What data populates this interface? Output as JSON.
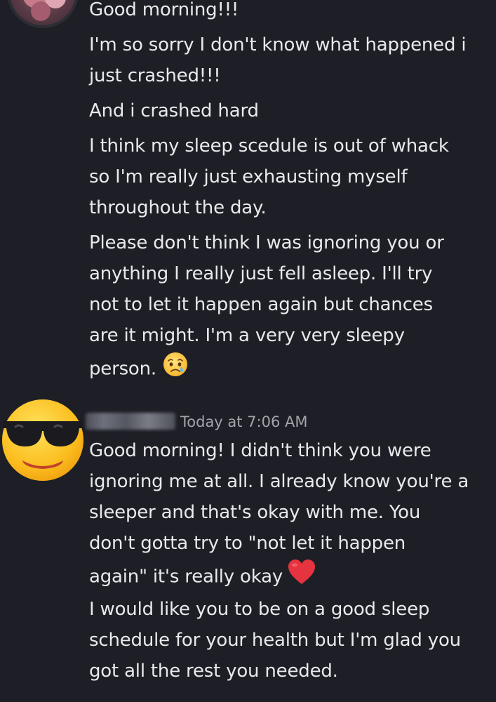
{
  "messages_prev": {
    "lines": [
      "Good morning!!!",
      "I'm so sorry I don't know what happened i",
      "just crashed!!!",
      "And i crashed hard",
      "I think my sleep scedule is out of whack",
      "so I'm really just exhausting myself",
      "throughout the day.",
      "Please don't think I was ignoring you or",
      "anything I really just fell asleep. I'll try",
      "not to let it happen again but chances",
      "are it might. I'm a very very sleepy",
      "person."
    ],
    "avatar_icon": "profile-photo",
    "end_emoji_icon": "crying-face-emoji"
  },
  "message_reply": {
    "timestamp": "Today at 7:06 AM",
    "avatar_icon": "sunglasses-face-emoji",
    "lines": [
      "Good morning! I didn't think you were",
      "ignoring me at all. I already know you're a",
      "sleeper and that's okay with me. You",
      "don't gotta try to \"not let it happen",
      "again\" it's really okay",
      "I would like you to be on a good sleep",
      "schedule for your health but I'm glad you",
      "got all the rest you needed."
    ],
    "heart_icon": "red-heart-emoji"
  },
  "colors": {
    "background": "#1e1f26",
    "text": "#e9e9ec",
    "timestamp": "#a3a4ab",
    "heart": "#e5333f"
  }
}
